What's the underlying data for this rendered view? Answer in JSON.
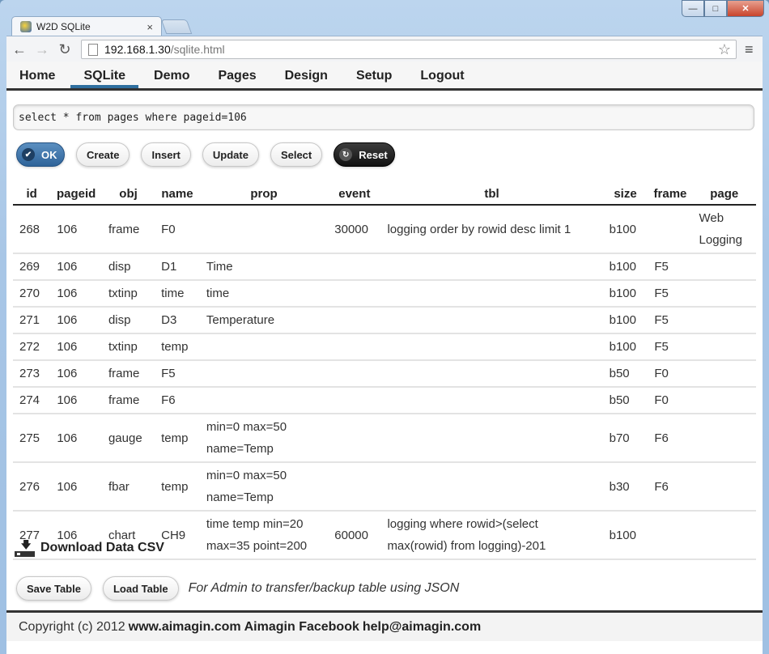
{
  "browser": {
    "tab_title": "W2D SQLite",
    "url_host": "192.168.1.30",
    "url_path": "/sqlite.html"
  },
  "nav": {
    "items": [
      "Home",
      "SQLite",
      "Demo",
      "Pages",
      "Design",
      "Setup",
      "Logout"
    ],
    "active": "SQLite"
  },
  "query": {
    "value": "select * from pages where pageid=106"
  },
  "buttons": {
    "ok": "OK",
    "create": "Create",
    "insert": "Insert",
    "update": "Update",
    "select": "Select",
    "reset": "Reset"
  },
  "table": {
    "columns": [
      "id",
      "pageid",
      "obj",
      "name",
      "prop",
      "event",
      "tbl",
      "size",
      "frame",
      "page"
    ],
    "rows": [
      {
        "id": "268",
        "pageid": "106",
        "obj": "frame",
        "name": "F0",
        "prop": [
          "",
          ""
        ],
        "event": "30000",
        "tbl": [
          "logging order by rowid desc limit 1",
          ""
        ],
        "size": "b100",
        "frame": "",
        "page": [
          "Web",
          "Logging"
        ]
      },
      {
        "id": "269",
        "pageid": "106",
        "obj": "disp",
        "name": "D1",
        "prop": [
          "Time",
          ""
        ],
        "event": "",
        "tbl": [
          "",
          ""
        ],
        "size": "b100",
        "frame": "F5",
        "page": [
          "",
          ""
        ]
      },
      {
        "id": "270",
        "pageid": "106",
        "obj": "txtinp",
        "name": "time",
        "prop": [
          "time",
          ""
        ],
        "event": "",
        "tbl": [
          "",
          ""
        ],
        "size": "b100",
        "frame": "F5",
        "page": [
          "",
          ""
        ]
      },
      {
        "id": "271",
        "pageid": "106",
        "obj": "disp",
        "name": "D3",
        "prop": [
          "Temperature",
          ""
        ],
        "event": "",
        "tbl": [
          "",
          ""
        ],
        "size": "b100",
        "frame": "F5",
        "page": [
          "",
          ""
        ]
      },
      {
        "id": "272",
        "pageid": "106",
        "obj": "txtinp",
        "name": "temp",
        "prop": [
          "",
          ""
        ],
        "event": "",
        "tbl": [
          "",
          ""
        ],
        "size": "b100",
        "frame": "F5",
        "page": [
          "",
          ""
        ]
      },
      {
        "id": "273",
        "pageid": "106",
        "obj": "frame",
        "name": "F5",
        "prop": [
          "",
          ""
        ],
        "event": "",
        "tbl": [
          "",
          ""
        ],
        "size": "b50",
        "frame": "F0",
        "page": [
          "",
          ""
        ]
      },
      {
        "id": "274",
        "pageid": "106",
        "obj": "frame",
        "name": "F6",
        "prop": [
          "",
          ""
        ],
        "event": "",
        "tbl": [
          "",
          ""
        ],
        "size": "b50",
        "frame": "F0",
        "page": [
          "",
          ""
        ]
      },
      {
        "id": "275",
        "pageid": "106",
        "obj": "gauge",
        "name": "temp",
        "prop": [
          "min=0 max=50",
          "name=Temp"
        ],
        "event": "",
        "tbl": [
          "",
          ""
        ],
        "size": "b70",
        "frame": "F6",
        "page": [
          "",
          ""
        ]
      },
      {
        "id": "276",
        "pageid": "106",
        "obj": "fbar",
        "name": "temp",
        "prop": [
          "min=0 max=50",
          "name=Temp"
        ],
        "event": "",
        "tbl": [
          "",
          ""
        ],
        "size": "b30",
        "frame": "F6",
        "page": [
          "",
          ""
        ]
      },
      {
        "id": "277",
        "pageid": "106",
        "obj": "chart",
        "name": "CH9",
        "prop": [
          "time temp min=20",
          "max=35 point=200"
        ],
        "event": "60000",
        "tbl": [
          "logging where rowid>(select",
          "max(rowid) from logging)-201"
        ],
        "size": "b100",
        "frame": "",
        "page": [
          "",
          ""
        ]
      }
    ]
  },
  "download": {
    "label": "Download Data CSV"
  },
  "backup": {
    "save": "Save Table",
    "load": "Load Table",
    "note": "For Admin to transfer/backup table using JSON"
  },
  "footer": {
    "copyright": "Copyright (c) 2012",
    "site": "www.aimagin.com",
    "facebook": "Aimagin Facebook",
    "email": "help@aimagin.com"
  }
}
